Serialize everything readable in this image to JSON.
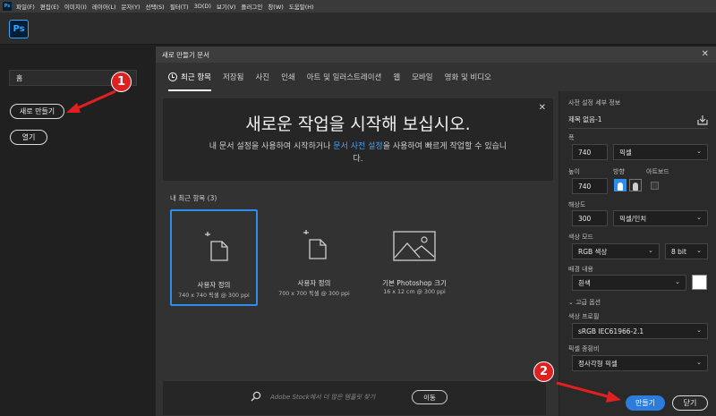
{
  "menubar": {
    "app_icon": "Ps",
    "items": [
      "파일(F)",
      "편집(E)",
      "이미지(I)",
      "레이어(L)",
      "문자(Y)",
      "선택(S)",
      "필터(T)",
      "3D(D)",
      "보기(V)",
      "플러그인",
      "창(W)",
      "도움말(H)"
    ]
  },
  "toolbar": {
    "logo": "Ps"
  },
  "left_panel": {
    "home": "홈",
    "new_button": "새로 만들기",
    "open_button": "열기"
  },
  "dialog": {
    "title": "새로 만들기 문서",
    "tabs": [
      "최근 항목",
      "저장됨",
      "사진",
      "인쇄",
      "아트 및 일러스트레이션",
      "웹",
      "모바일",
      "영화 및 비디오"
    ],
    "hero": {
      "heading": "새로운 작업을 시작해 보십시오.",
      "text_before": "내 문서 설정을 사용하여 시작하거나 ",
      "link": "문서 사전 설정",
      "text_after": "을 사용하여 빠르게 작업할 수 있습니다."
    },
    "recent_label": "내 최근 항목 (3)",
    "cards": [
      {
        "name": "사용자 정의",
        "size": "740 x 740 픽셀 @ 300 ppi",
        "icon": "blank-document-icon"
      },
      {
        "name": "사용자 정의",
        "size": "700 x 700 픽셀 @ 300 ppi",
        "icon": "blank-document-icon"
      },
      {
        "name": "기본 Photoshop 크기",
        "size": "16 x 12 cm @ 300 ppi",
        "icon": "image-document-icon"
      }
    ],
    "search": {
      "placeholder": "Adobe Stock에서 더 많은 템플릿 찾기",
      "go_button": "이동"
    }
  },
  "details": {
    "heading": "사전 설정 세부 정보",
    "doc_name": "제목 없음-1",
    "width_label": "폭",
    "width_value": "740",
    "width_unit": "픽셀",
    "height_label": "높이",
    "height_value": "740",
    "orientation_label": "방향",
    "artboard_label": "아트보드",
    "resolution_label": "해상도",
    "resolution_value": "300",
    "resolution_unit": "픽셀/인치",
    "color_mode_label": "색상 모드",
    "color_mode_value": "RGB 색상",
    "bit_depth": "8 bit",
    "bg_label": "배경 내용",
    "bg_value": "흰색",
    "bg_color": "#ffffff",
    "advanced_label": "고급 옵션",
    "profile_label": "색상 프로필",
    "profile_value": "sRGB IEC61966-2.1",
    "pixel_ratio_label": "픽셀 종횡비",
    "pixel_ratio_value": "정사각형 픽셀",
    "create_button": "만들기",
    "close_button": "닫기"
  },
  "annotations": {
    "badge_1": "1",
    "badge_2": "2",
    "color": "#e02020"
  },
  "colors": {
    "accent": "#2c8ff0",
    "primary_button": "#2c7cde",
    "badge": "#e02020"
  }
}
